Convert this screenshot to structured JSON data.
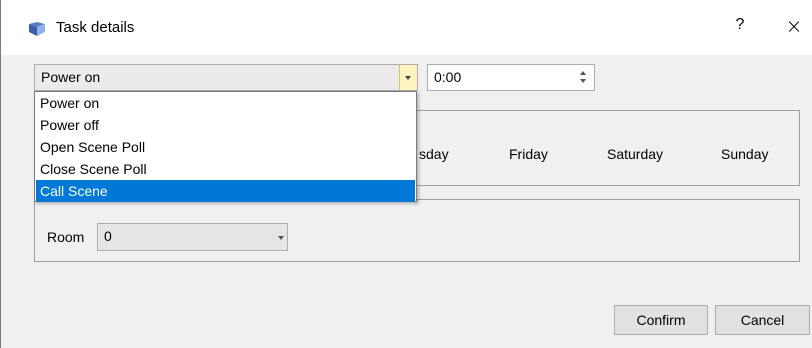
{
  "window": {
    "title": "Task details",
    "help": "?",
    "close": "×"
  },
  "action_combo": {
    "value": "Power on",
    "options": [
      "Power on",
      "Power off",
      "Open Scene Poll",
      "Close Scene Poll",
      "Call Scene"
    ],
    "highlighted_index": 4
  },
  "time_spin": {
    "value": "0:00"
  },
  "days": {
    "partial_label": "sday",
    "friday": "Friday",
    "saturday": "Saturday",
    "sunday": "Sunday"
  },
  "parameter": {
    "room_label": "Room",
    "room_value": "0"
  },
  "buttons": {
    "confirm": "Confirm",
    "cancel": "Cancel"
  },
  "colors": {
    "selection": "#0078d7",
    "combo_focus_arrow_bg": "#fff4c0"
  }
}
